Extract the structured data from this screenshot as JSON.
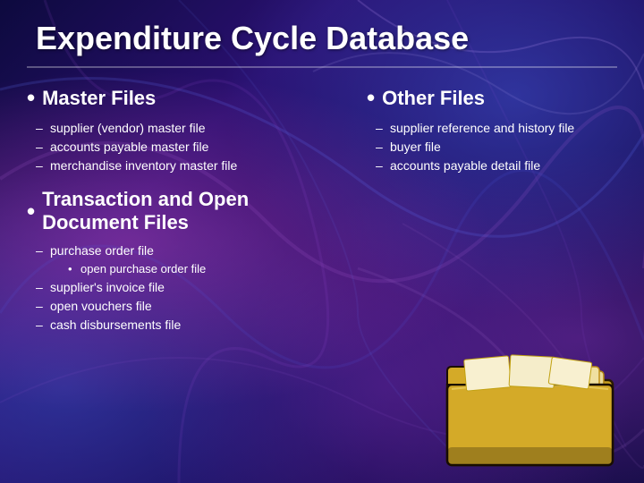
{
  "slide": {
    "title": "Expenditure Cycle Database",
    "left": {
      "section1": {
        "header": "Master Files",
        "items": [
          "supplier (vendor) master file",
          "accounts payable master file",
          "merchandise inventory master file"
        ]
      },
      "section2": {
        "header": "Transaction and Open Document Files",
        "items": [
          "purchase order file",
          "supplier's invoice file",
          "open vouchers file",
          "cash disbursements file"
        ],
        "subItems": {
          "parentIndex": 0,
          "children": [
            "open purchase order file"
          ]
        }
      }
    },
    "right": {
      "section1": {
        "header": "Other Files",
        "items": [
          "supplier reference and history file",
          "buyer file",
          "accounts payable detail file"
        ]
      }
    }
  }
}
